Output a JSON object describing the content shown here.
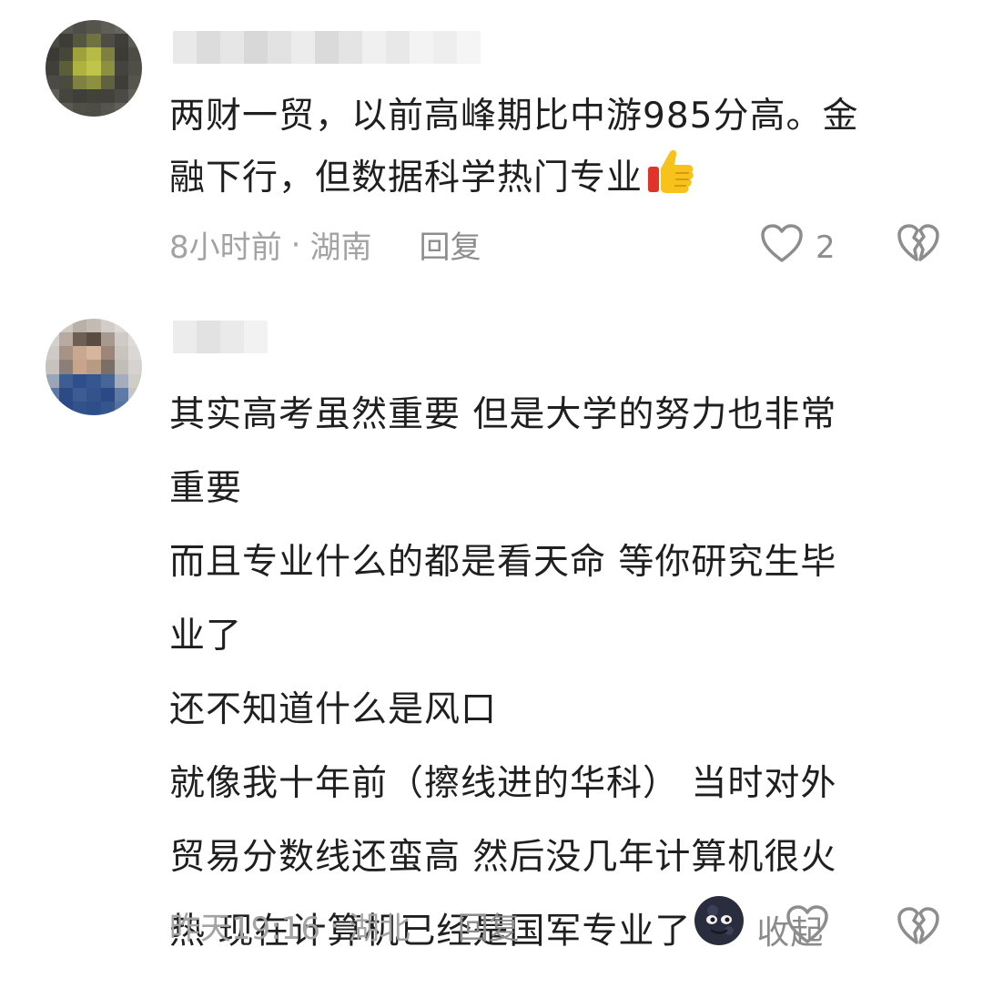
{
  "comments": [
    {
      "body_lines": [
        "两财一贸，以前高峰期比中游985分高。金",
        "融下行，但数据科学热门专业"
      ],
      "emoji": "thumbs-up-emoji",
      "time": "8小时前",
      "separator": "·",
      "location": "湖南",
      "reply_label": "回复",
      "like_count": "2",
      "icons": [
        "heart-outline-icon",
        "broken-heart-icon"
      ]
    },
    {
      "body_lines": [
        "其实高考虽然重要 但是大学的努力也非常",
        "重要",
        "而且专业什么的都是看天命 等你研究生毕",
        "业了",
        "还不知道什么是风口",
        "就像我十年前（擦线进的华科） 当时对外",
        "贸易分数线还蛮高 然后没几年计算机很火",
        "热 现在计算机已经是国军专业了"
      ],
      "emoji": "new-moon-face-emoji",
      "collapse_label": "收起",
      "time": "昨天19:16",
      "separator": "·",
      "location": "湖北",
      "reply_label": "回复",
      "icons": [
        "heart-outline-icon",
        "broken-heart-icon"
      ]
    }
  ],
  "colors": {
    "text": "#1f1f1f",
    "meta": "#a3a3a3",
    "icon": "#8d8d8d",
    "background": "#ffffff"
  }
}
